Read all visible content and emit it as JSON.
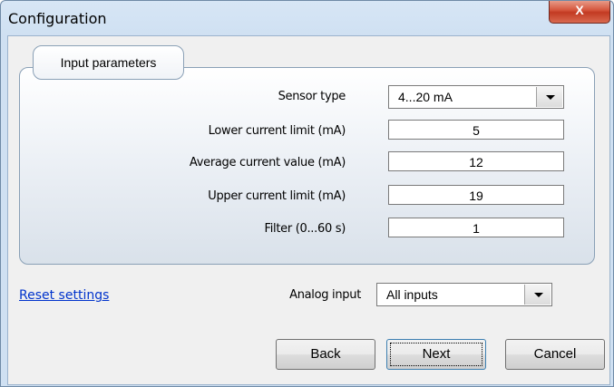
{
  "window": {
    "title": "Configuration",
    "close_label": "X"
  },
  "group": {
    "title": "Input parameters"
  },
  "fields": {
    "sensor_type": {
      "label": "Sensor type",
      "value": "4...20 mA"
    },
    "lower_current": {
      "label": "Lower current limit (mA)",
      "value": "5"
    },
    "average_current": {
      "label": "Average current value (mA)",
      "value": "12"
    },
    "upper_current": {
      "label": "Upper current limit (mA)",
      "value": "19"
    },
    "filter": {
      "label": "Filter (0...60 s)",
      "value": "1"
    },
    "analog_input": {
      "label": "Analog input",
      "value": "All inputs"
    }
  },
  "reset_link": "Reset settings",
  "buttons": {
    "back": "Back",
    "next": "Next",
    "cancel": "Cancel"
  },
  "icons": {
    "close": "close-icon",
    "dropdown": "chevron-down-icon"
  }
}
